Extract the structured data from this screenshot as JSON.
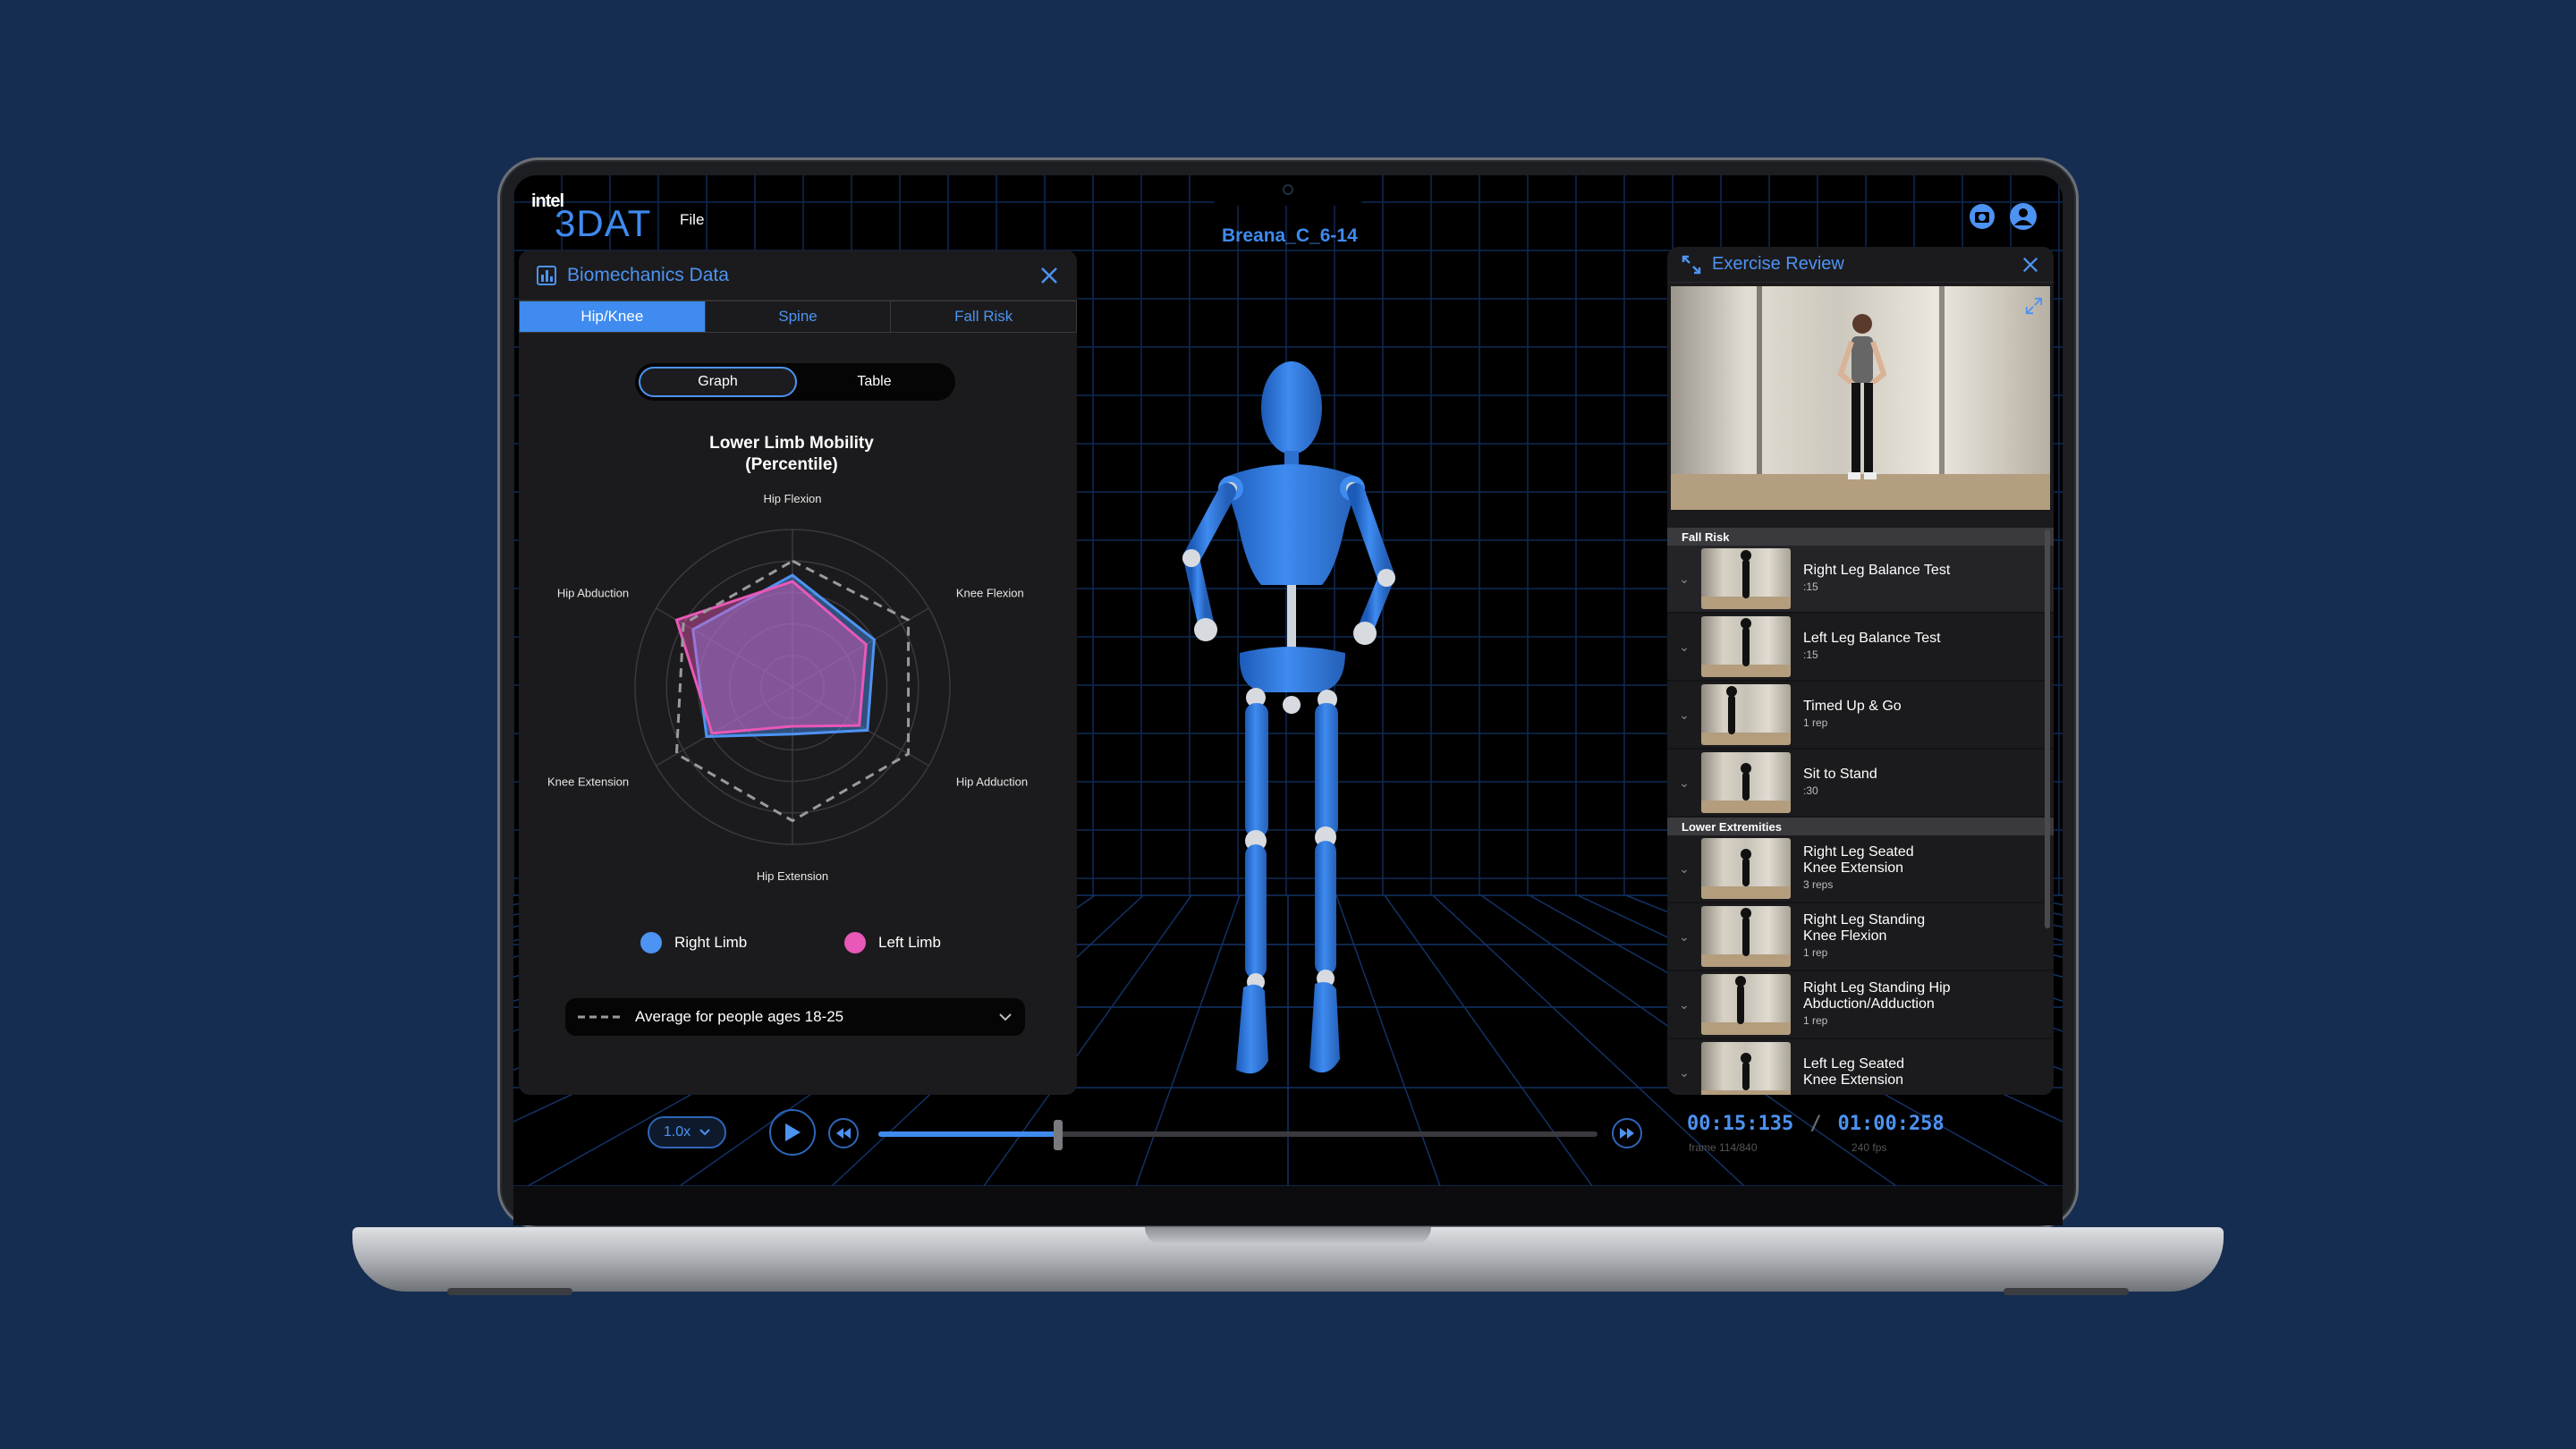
{
  "app": {
    "logo_small": "intel",
    "logo_big": "3DAT",
    "menu_file": "File",
    "session_title": "Breana_C_6-14"
  },
  "biomechanics": {
    "title": "Biomechanics Data",
    "tabs": [
      {
        "label": "Hip/Knee",
        "active": true
      },
      {
        "label": "Spine",
        "active": false
      },
      {
        "label": "Fall Risk",
        "active": false
      }
    ],
    "view_toggle": {
      "graph": "Graph",
      "table": "Table",
      "selected": "Graph"
    },
    "legend": {
      "right": "Right Limb",
      "left": "Left Limb"
    },
    "average_dropdown": "Average for people ages 18-25"
  },
  "chart_data": {
    "type": "radar",
    "title": "Lower Limb Mobility\n(Percentile)",
    "axes": [
      "Hip Flexion",
      "Knee Flexion",
      "Hip Adduction",
      "Hip Extension",
      "Knee Extension",
      "Hip Abduction"
    ],
    "rmax": 100,
    "rings": 5,
    "series": [
      {
        "name": "Right Limb",
        "color": "#4d93f2",
        "values": [
          71,
          60,
          55,
          30,
          63,
          73
        ]
      },
      {
        "name": "Left Limb",
        "color": "#e858b8",
        "values": [
          67,
          54,
          49,
          25,
          59,
          85
        ]
      },
      {
        "name": "Average for people ages 18-25",
        "color": "#9a9a9e",
        "dashed": true,
        "values": [
          80,
          85,
          85,
          85,
          85,
          80
        ]
      }
    ]
  },
  "exercise_review": {
    "title": "Exercise Review",
    "groups": [
      {
        "label": "Fall Risk",
        "items": [
          {
            "title": "Right Leg Balance Test",
            "title2": "",
            "sub": ":15"
          },
          {
            "title": "Left Leg Balance Test",
            "title2": "",
            "sub": ":15"
          },
          {
            "title": "Timed Up & Go",
            "title2": "",
            "sub": "1 rep"
          },
          {
            "title": "Sit to Stand",
            "title2": "",
            "sub": ":30"
          }
        ]
      },
      {
        "label": "Lower Extremities",
        "items": [
          {
            "title": "Right Leg Seated",
            "title2": "Knee Extension",
            "sub": "3 reps"
          },
          {
            "title": "Right Leg Standing",
            "title2": "Knee Flexion",
            "sub": "1 rep"
          },
          {
            "title": "Right Leg Standing Hip",
            "title2": "Abduction/Adduction",
            "sub": "1 rep"
          },
          {
            "title": "Left Leg Seated",
            "title2": "Knee Extension",
            "sub": ""
          }
        ]
      }
    ]
  },
  "playback": {
    "speed": "1.0x",
    "progress": 0.25,
    "current_time": "00:15:135",
    "separator": "/",
    "total_time": "01:00:258",
    "frame_info": "frame 114/840",
    "fps_info": "240 fps"
  },
  "icons": {
    "chart": "bar-chart-icon",
    "close": "close-icon",
    "expand": "expand-icon",
    "camera": "camera-icon",
    "user": "user-icon",
    "play": "play-icon",
    "rewind": "rewind-icon",
    "forward": "fast-forward-icon"
  },
  "colors": {
    "accent": "#3f8bf0",
    "right_limb": "#4d93f2",
    "left_limb": "#e858b8",
    "background": "#152d50"
  }
}
